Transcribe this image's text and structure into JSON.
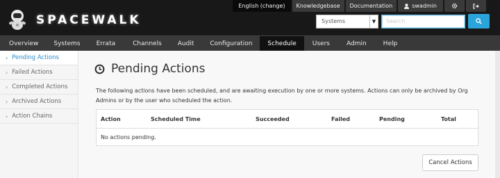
{
  "header": {
    "logo_text": "SPACEWALK",
    "language": "English (change)",
    "knowledgebase": "Knowledgebase",
    "documentation": "Documentation",
    "user": "swadmin",
    "user_icon": "user-icon",
    "settings_icon": "gear-icon",
    "logout_icon": "sign-out-icon"
  },
  "search": {
    "scope": "Systems",
    "placeholder": "Search",
    "value": ""
  },
  "nav": {
    "items": [
      "Overview",
      "Systems",
      "Errata",
      "Channels",
      "Audit",
      "Configuration",
      "Schedule",
      "Users",
      "Admin",
      "Help"
    ],
    "active": "Schedule"
  },
  "sidebar": {
    "items": [
      "Pending Actions",
      "Failed Actions",
      "Completed Actions",
      "Archived Actions",
      "Action Chains"
    ],
    "active": "Pending Actions"
  },
  "main": {
    "title": "Pending Actions",
    "title_icon": "clock-icon",
    "description": "The following actions have been scheduled, and are awaiting execution by one or more systems. Actions can only be archived by Org Admins or by the user who scheduled the action.",
    "table": {
      "columns": [
        "Action",
        "Scheduled Time",
        "Succeeded",
        "Failed",
        "Pending",
        "Total"
      ],
      "empty_message": "No actions pending."
    },
    "cancel_button": "Cancel Actions"
  },
  "colors": {
    "header_bg": "#181818",
    "nav_bg": "#393939",
    "accent": "#2aa5dc",
    "active_link": "#2a8ccc"
  }
}
